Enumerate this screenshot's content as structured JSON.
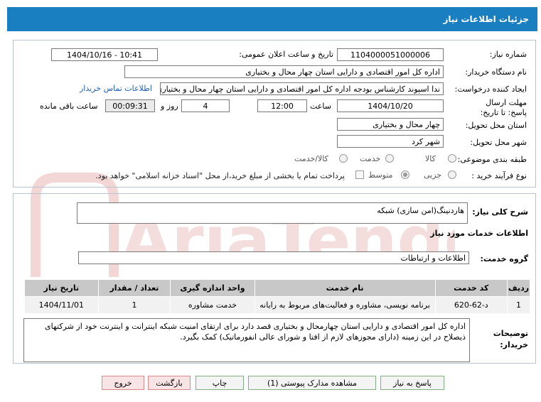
{
  "header": {
    "title": "جزئیات اطلاعات نیاز"
  },
  "form": {
    "need_number_label": "شماره نیاز:",
    "need_number": "1104000051000006",
    "announce_label": "تاریخ و ساعت اعلان عمومی:",
    "announce_value": "1404/10/16 - 10:41",
    "buyer_label": "نام دستگاه خریدار:",
    "buyer_value": "اداره کل امور اقتصادی و دارایی استان چهار محال و بختیاری",
    "creator_label": "ایجاد کننده درخواست:",
    "creator_value": "ندا اسپوند کارشناس بودجه اداره کل امور اقتصادی و دارایی استان چهار محال و بختیاری",
    "contact_link": "اطلاعات تماس خریدار",
    "deadline_label": "مهلت ارسال پاسخ: تا تاریخ:",
    "deadline_date": "1404/10/20",
    "time_label": "ساعت",
    "deadline_time": "12:00",
    "days_value": "4",
    "day_and_label": "روز و",
    "remaining_value": "00:09:31",
    "remaining_label": "ساعت باقی مانده",
    "province_label": "استان محل تحویل:",
    "province_value": "چهار محال و بختیاری",
    "city_label": "شهر محل تحویل:",
    "city_value": "شهر کرد",
    "category_label": "طبقه بندی موضوعی:",
    "category_options": [
      "کالا",
      "خدمت",
      "کالا/خدمت"
    ],
    "process_label": "نوع فرآیند خرید :",
    "process_options": [
      "جزیی",
      "متوسط"
    ],
    "payment_note": "پرداخت تمام یا بخشی از مبلغ خرید،از محل \"اسناد خزانه اسلامی\" خواهد بود."
  },
  "summary": {
    "desc_label": "شرح کلی نیاز:",
    "desc_value": "هاردنینگ(امن سازی) شبکه",
    "services_title": "اطلاعات خدمات مورد نیاز",
    "group_label": "گروه خدمت:",
    "group_value": "اطلاعات و ارتباطات"
  },
  "table": {
    "headers": [
      "ردیف",
      "کد خدمت",
      "نام خدمت",
      "واحد اندازه گیری",
      "تعداد / مقدار",
      "تاریخ نیاز"
    ],
    "rows": [
      [
        "1",
        "د-62-620",
        "برنامه نویسی، مشاوره و فعالیت‌های مربوط به رایانه",
        "خدمت مشاوره",
        "1",
        "1404/11/01"
      ]
    ]
  },
  "notes": {
    "label": "توضیحات خریدار:",
    "text": "اداره کل امور اقتصادی و دارایی استان چهارمحال و بختیاری قصد دارد برای ارتقای امنیت شبکه اینترانت و اینترنت خود از شرکتهای ذیصلاح در این زمینه (دارای مجوزهای لازم از افتا و شورای عالی انفورماتیک) کمک بگیرد."
  },
  "buttons": {
    "reply": "پاسخ به نیاز",
    "docs": "مشاهده مدارک پیوستی (1)",
    "print": "چاپ",
    "back": "بازگشت",
    "exit": "خروج"
  },
  "colors": {
    "header": "#1a7fc1",
    "table_header": "#c8c8c8",
    "watermark": "#f0d0d0"
  }
}
